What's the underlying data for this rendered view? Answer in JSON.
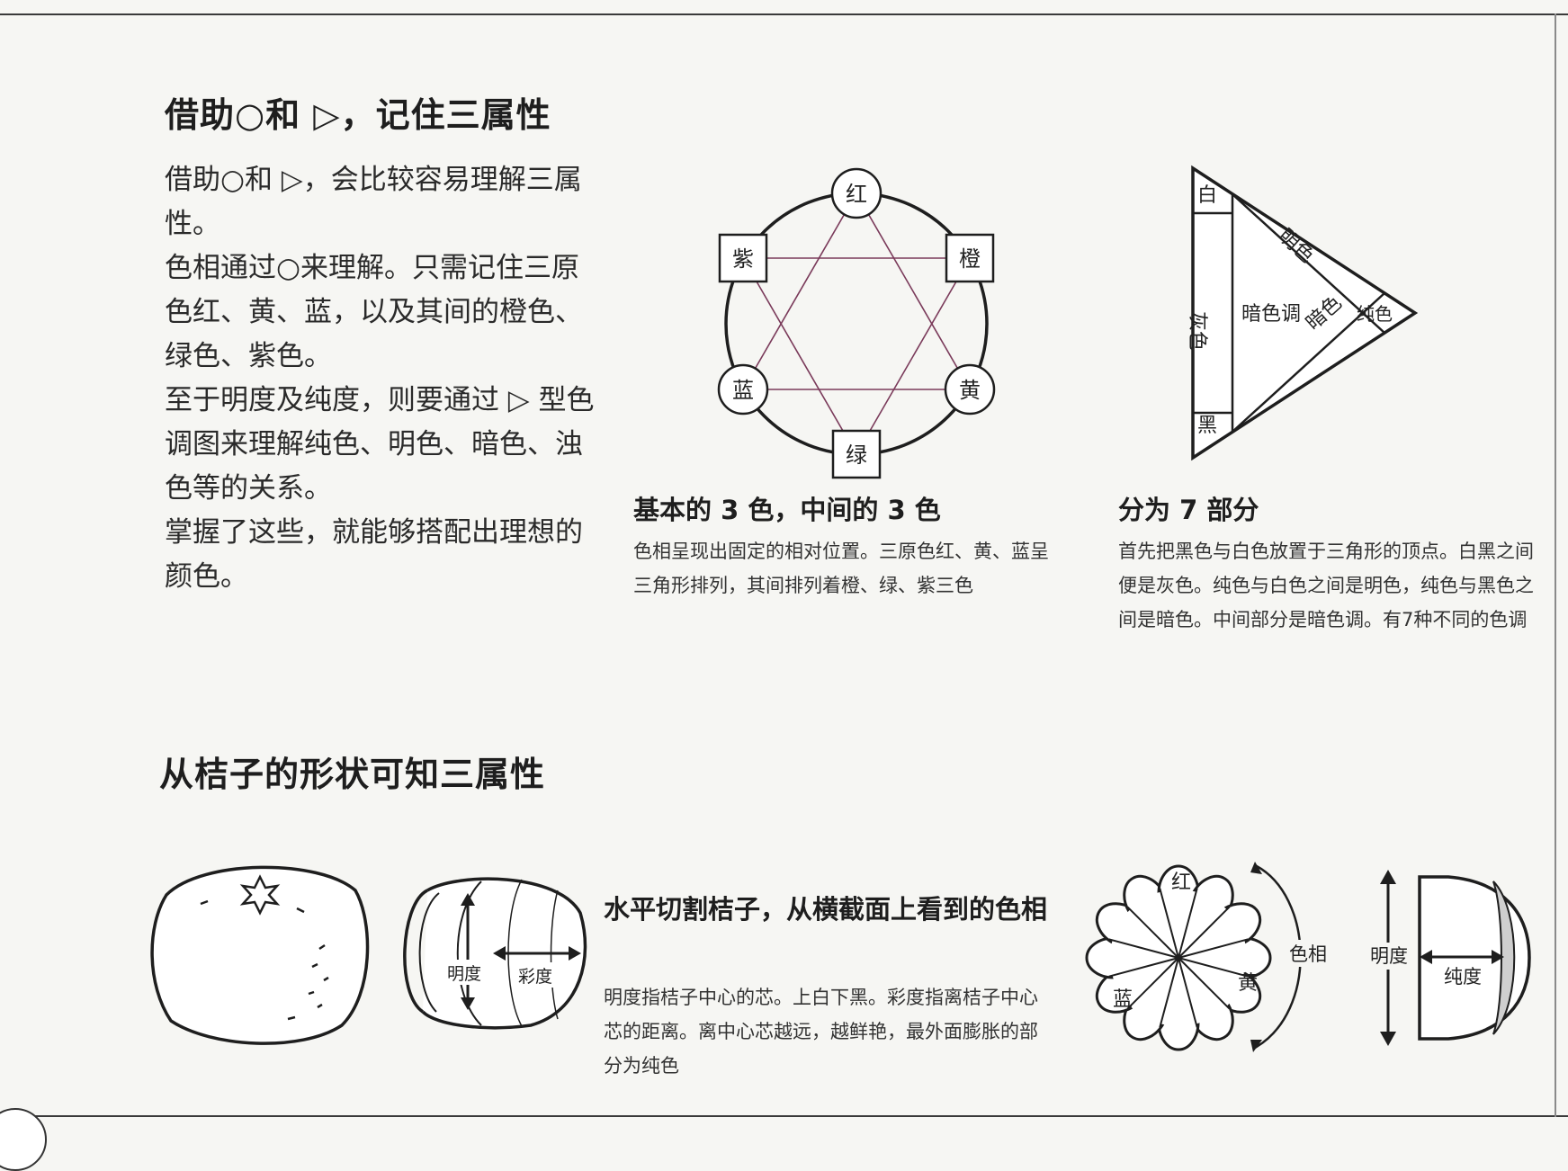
{
  "section1": {
    "title": "借助○和 ▷，记住三属性",
    "paragraphs": [
      "借助○和 ▷，会比较容易理解三属性。",
      "色相通过○来理解。只需记住三原色红、黄、蓝，以及其间的橙色、绿色、紫色。",
      "至于明度及纯度，则要通过 ▷ 型色调图来理解纯色、明色、暗色、浊色等的关系。",
      "掌握了这些，就能够搭配出理想的颜色。"
    ]
  },
  "hue_circle": {
    "labels": {
      "top": "红",
      "upper_right": "橙",
      "lower_right": "黄",
      "bottom": "绿",
      "lower_left": "蓝",
      "upper_left": "紫"
    },
    "caption_title": "基本的 3 色，中间的 3 色",
    "caption_text": "色相呈现出固定的相对位置。三原色红、黄、蓝呈三角形排列，其间排列着橙、绿、紫三色"
  },
  "tone_triangle": {
    "labels": {
      "white": "白",
      "gray": "灰色",
      "black": "黑",
      "light": "明色",
      "dull": "暗色调",
      "dark": "暗色",
      "pure": "纯色"
    },
    "caption_title": "分为 7 部分",
    "caption_text": "首先把黑色与白色放置于三角形的顶点。白黑之间便是灰色。纯色与白色之间是明色，纯色与黑色之间是暗色。中间部分是暗色调。有7种不同的色调"
  },
  "section2": {
    "title": "从桔子的形状可知三属性"
  },
  "orange_half": {
    "lightness": "明度",
    "chroma": "彩度"
  },
  "orange_caption": {
    "title": "水平切割桔子，从横截面上看到的色相",
    "text": "明度指桔子中心的芯。上白下黑。彩度指离桔子中心芯的距离。离中心芯越远，越鲜艳，最外面膨胀的部分为纯色"
  },
  "orange_cross": {
    "red": "红",
    "yellow": "黄",
    "blue": "蓝",
    "hue": "色相"
  },
  "orange_side": {
    "lightness": "明度",
    "purity": "纯度"
  }
}
